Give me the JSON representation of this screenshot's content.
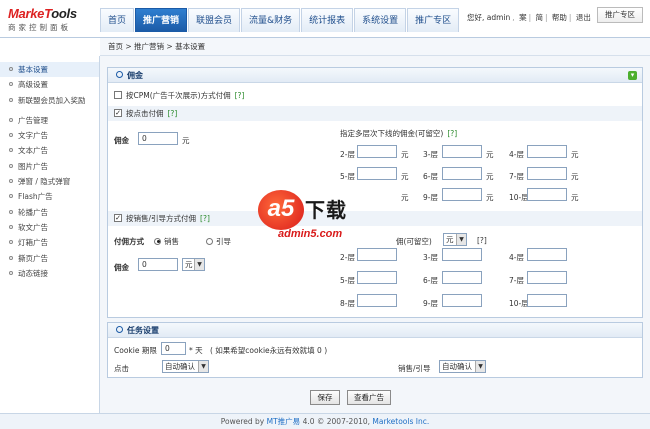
{
  "header": {
    "logo_main_a": "Marke",
    "logo_main_b": "ools",
    "logo_sub": "商家控制面板",
    "nav": [
      "首页",
      "推广营销",
      "联盟会员",
      "流量&财务",
      "统计报表",
      "系统设置",
      "推广专区"
    ],
    "user_text": "您好, admin",
    "links": [
      "案",
      "简",
      "帮助",
      "退出"
    ],
    "promo_button": "推广专区"
  },
  "breadcrumb": "首页 > 推广营销 > 基本设置",
  "sidebar": {
    "group1": [
      "基本设置",
      "高级设置",
      "新联盟会员加入奖励"
    ],
    "group2": [
      "广告管理",
      "文字广告",
      "文本广告",
      "图片广告",
      "弹窗 / 隐式弹窗",
      "Flash广告",
      "轮播广告",
      "软文广告",
      "灯箱广告",
      "撕页广告",
      "动态链接"
    ]
  },
  "commission": {
    "title": "佣金",
    "cpm_label": "按CPM(广告千次展示)方式付佣",
    "help": "[?]",
    "click_label": "按点击付佣",
    "amount_label": "佣金",
    "amount_value": "0",
    "unit": "元",
    "levels_title": "指定多层次下线的佣金(可留空)",
    "levels": [
      "2-层",
      "3-层",
      "4-层",
      "5-层",
      "6-层",
      "7-层",
      "8-层",
      "9-层",
      "10-层"
    ],
    "sales_label": "按销售/引导方式付佣",
    "pay_method_label": "付佣方式",
    "radio_sales": "销售",
    "radio_lead": "引导",
    "levels_title2_tail": "佣(可留空)",
    "unit_select": "元"
  },
  "task": {
    "title": "任务设置",
    "cookie_label": "Cookie 期限",
    "cookie_value": "0",
    "cookie_unit": "* 天",
    "cookie_hint": "( 如果希望cookie永远有效就填 0 )",
    "click_label": "点击",
    "click_select": "自动确认",
    "sales_label": "销售/引导",
    "sales_select": "自动确认"
  },
  "buttons": {
    "save": "保存",
    "view_ads": "查看广告"
  },
  "footer": {
    "powered": "Powered by ",
    "product": "MT推广易",
    "version": " 4.0 © 2007-2010, ",
    "company": "Marketools Inc."
  },
  "watermark": {
    "a": "a5",
    "cn": "下载",
    "url": "admin5.com"
  }
}
